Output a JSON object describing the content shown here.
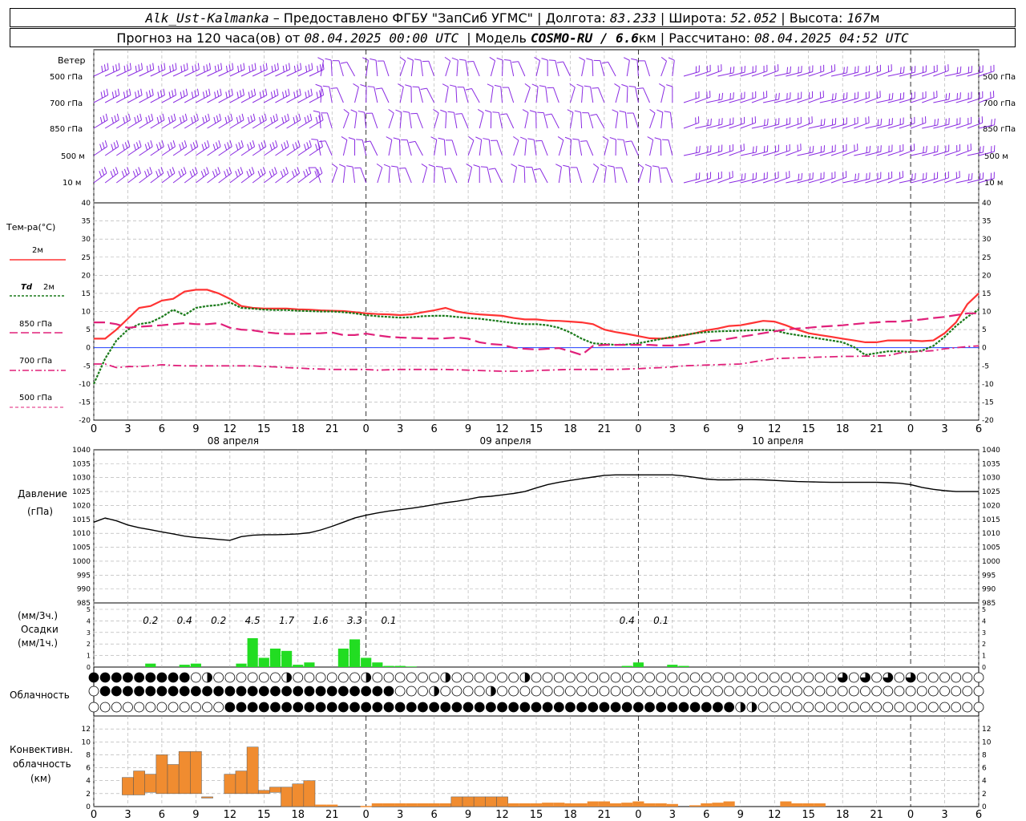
{
  "header": {
    "station": "Alk_Ust-Kalmanka",
    "dash": "–",
    "provider": "Предоставлено ФГБУ \"ЗапСиб УГМС\"",
    "lon_label": "Долгота:",
    "lon": "83.233",
    "lat_label": "Широта:",
    "lat": "52.052",
    "alt_label": "Высота:",
    "alt": "167",
    "alt_unit": "м",
    "forecast_label": "Прогноз на 120 часа(ов) от",
    "forecast_time": "08.04.2025 00:00 UTC",
    "model_label": "Модель",
    "model": "COSMO-RU / 6.6",
    "model_unit": "км",
    "calc_label": "Рассчитано:",
    "calc_time": "08.04.2025 04:52 UTC",
    "sep": "|"
  },
  "labels": {
    "wind": "Ветер",
    "wind_levels": [
      "500 гПа",
      "700 гПа",
      "850 гПа",
      "500 м",
      "10 м"
    ],
    "temp": "Тем-ра(°С)",
    "t2m": "2м",
    "td": "Td",
    "td2": "2м",
    "l850": "850 гПа",
    "l700": "700 гПа",
    "l500": "500 гПа",
    "pressure": "Давление",
    "pressure_unit": "(гПа)",
    "precip_unit3": "(мм/3ч.)",
    "precip": "Осадки",
    "precip_unit1": "(мм/1ч.)",
    "cloud": "Облачность",
    "conv1": "Конвективн.",
    "conv2": "облачность",
    "conv3": "(км)"
  },
  "colors": {
    "t2m": "#ff3333",
    "td": "#1a7a1a",
    "t850": "#e0207a",
    "t700": "#e0207a",
    "t500": "#e0207a",
    "wind": "#8a2be2",
    "precip": "#22dd22",
    "conv": "#f08c30",
    "zero": "#2040ff"
  },
  "chart_data": [
    {
      "type": "line",
      "name": "temperature",
      "x_hours": [
        0,
        1,
        2,
        3,
        4,
        5,
        6,
        7,
        8,
        9,
        10,
        11,
        12,
        13,
        14,
        15,
        16,
        17,
        18,
        19,
        20,
        21,
        22,
        23,
        24,
        25,
        26,
        27,
        28,
        29,
        30,
        31,
        32,
        33,
        34,
        35,
        36,
        37,
        38,
        39,
        40,
        41,
        42,
        43,
        44,
        45,
        46,
        47,
        48,
        49,
        50,
        51,
        52,
        53,
        54,
        55,
        56,
        57,
        58,
        59,
        60,
        61,
        62,
        63,
        64,
        65,
        66,
        67,
        68,
        69,
        70,
        71,
        72,
        73,
        74,
        75,
        76,
        77,
        78
      ],
      "x_tick_labels": [
        "0",
        "3",
        "6",
        "9",
        "12",
        "15",
        "18",
        "21",
        "0",
        "3",
        "6",
        "9",
        "12",
        "15",
        "18",
        "21",
        "0",
        "3",
        "6",
        "9",
        "12",
        "15",
        "18",
        "21",
        "0",
        "3",
        "6"
      ],
      "day_labels": [
        "08 апреля",
        "09 апреля",
        "10 апреля"
      ],
      "ylim": [
        -20,
        40
      ],
      "yticks": [
        40,
        35,
        30,
        25,
        20,
        15,
        10,
        5,
        0,
        -5,
        -10,
        -15,
        -20
      ],
      "series": [
        {
          "name": "2м",
          "values": [
            2.5,
            2.5,
            5,
            8,
            11,
            11.5,
            13,
            13.5,
            15.5,
            16,
            16,
            15,
            13.5,
            11.5,
            11,
            10.8,
            10.8,
            10.8,
            10.6,
            10.5,
            10.3,
            10.2,
            10.1,
            9.8,
            9.5,
            9.3,
            9.2,
            9,
            9.2,
            9.8,
            10.3,
            11,
            10,
            9.5,
            9.2,
            9,
            8.8,
            8.2,
            7.8,
            7.8,
            7.5,
            7.4,
            7.2,
            7,
            6.5,
            5,
            4.3,
            3.8,
            3.2,
            2.6,
            2.5,
            2.8,
            3.4,
            4,
            4.8,
            5.3,
            6,
            6.2,
            6.8,
            7.4,
            7.2,
            6.2,
            5,
            4,
            3.5,
            3,
            2.5,
            2,
            1.5,
            1.5,
            2,
            2,
            2,
            1.8,
            2,
            4,
            7,
            12,
            15
          ]
        },
        {
          "name": "Td 2м",
          "values": [
            -10,
            -3,
            2,
            5,
            6.5,
            7,
            8.5,
            10.5,
            9,
            11,
            11.5,
            11.8,
            12.5,
            11,
            10.8,
            10.5,
            10.4,
            10.4,
            10.2,
            10.1,
            10,
            10,
            9.8,
            9.5,
            9,
            8.7,
            8.5,
            8.3,
            8.4,
            8.7,
            8.8,
            8.8,
            8.5,
            8.2,
            8,
            7.6,
            7.2,
            6.8,
            6.5,
            6.5,
            6.2,
            5.5,
            4.2,
            2.5,
            1.2,
            1,
            0.8,
            0.9,
            1.2,
            1.8,
            2.4,
            3,
            3.5,
            4,
            4.3,
            4.5,
            4.6,
            4.7,
            4.8,
            4.9,
            4.8,
            4,
            3.5,
            3,
            2.5,
            2,
            1.5,
            0.2,
            -2,
            -1.5,
            -1,
            -1,
            -1.2,
            -0.8,
            0.5,
            3,
            6,
            8.5,
            10.5
          ]
        },
        {
          "name": "850 гПа",
          "values": [
            7,
            7,
            6.5,
            5.5,
            5.8,
            6,
            6.2,
            6.5,
            6.8,
            6.5,
            6.5,
            6.8,
            5.5,
            5,
            4.8,
            4.3,
            4,
            3.8,
            3.8,
            3.9,
            4,
            4.2,
            3.5,
            3.5,
            3.9,
            3.4,
            3,
            2.8,
            2.7,
            2.6,
            2.5,
            2.6,
            2.8,
            2.5,
            1.5,
            1,
            0.8,
            0,
            -0.3,
            -0.5,
            -0.3,
            -0.1,
            -1,
            -2,
            0.5,
            0.8,
            0.8,
            0.8,
            0.8,
            0.8,
            0.6,
            0.6,
            0.8,
            1.2,
            1.8,
            2,
            2.5,
            3,
            3.5,
            4,
            4.5,
            5,
            5.3,
            5.5,
            5.8,
            6,
            6.2,
            6.5,
            6.8,
            7,
            7.2,
            7.2,
            7.5,
            7.8,
            8.2,
            8.5,
            9,
            9.5,
            9.5
          ]
        },
        {
          "name": "700 гПа",
          "values": [
            -4.5,
            -4.5,
            -5.5,
            -5.2,
            -5.2,
            -5,
            -4.7,
            -4.9,
            -5,
            -5,
            -5,
            -5,
            -5,
            -5,
            -5,
            -5.2,
            -5.3,
            -5.5,
            -5.6,
            -5.8,
            -5.9,
            -6,
            -6,
            -6,
            -6,
            -6.2,
            -6.1,
            -6,
            -6,
            -6,
            -6,
            -6,
            -6.1,
            -6.2,
            -6.3,
            -6.4,
            -6.5,
            -6.5,
            -6.5,
            -6.3,
            -6.2,
            -6.1,
            -6,
            -6,
            -6,
            -6,
            -6,
            -5.9,
            -5.8,
            -5.6,
            -5.5,
            -5.3,
            -5,
            -4.9,
            -4.8,
            -4.7,
            -4.6,
            -4.5,
            -4,
            -3.5,
            -3,
            -2.9,
            -2.8,
            -2.7,
            -2.6,
            -2.5,
            -2.4,
            -2.4,
            -2.3,
            -2.3,
            -2.2,
            -1.5,
            -1.2,
            -1,
            -0.8,
            -0.3,
            0,
            0.3,
            0.5
          ]
        }
      ],
      "zero_line": 0
    },
    {
      "type": "line",
      "name": "pressure",
      "ylim": [
        985,
        1040
      ],
      "yticks": [
        1040,
        1035,
        1030,
        1025,
        1020,
        1015,
        1010,
        1005,
        1000,
        995,
        990,
        985
      ],
      "values": [
        1014,
        1015.5,
        1014.5,
        1013,
        1012,
        1011.3,
        1010.5,
        1009.8,
        1009,
        1008.5,
        1008.2,
        1007.8,
        1007.5,
        1008.8,
        1009.3,
        1009.5,
        1009.5,
        1009.6,
        1009.8,
        1010.2,
        1011.2,
        1012.5,
        1014,
        1015.5,
        1016.5,
        1017.3,
        1018,
        1018.5,
        1019,
        1019.6,
        1020.3,
        1021,
        1021.5,
        1022.2,
        1023,
        1023.3,
        1023.8,
        1024.3,
        1025,
        1026.3,
        1027.5,
        1028.3,
        1029,
        1029.6,
        1030.2,
        1030.8,
        1031,
        1031,
        1031,
        1031,
        1031,
        1031,
        1030.6,
        1030.1,
        1029.5,
        1029.2,
        1029.2,
        1029.3,
        1029.3,
        1029.2,
        1029,
        1028.8,
        1028.6,
        1028.5,
        1028.4,
        1028.3,
        1028.3,
        1028.3,
        1028.3,
        1028.3,
        1028.2,
        1028,
        1027.5,
        1026.5,
        1025.8,
        1025.3,
        1025,
        1025,
        1025
      ]
    },
    {
      "type": "bar",
      "name": "precipitation",
      "ylim": [
        0,
        5
      ],
      "yticks": [
        5,
        4,
        3,
        2,
        1,
        0
      ],
      "mm_per_hour": [
        0,
        0,
        0,
        0,
        0,
        0.3,
        0,
        0,
        0.2,
        0.3,
        0,
        0,
        0,
        0.3,
        2.5,
        0.8,
        1.6,
        1.4,
        0.2,
        0.4,
        0,
        0,
        1.6,
        2.4,
        0.8,
        0.4,
        0.1,
        0.1,
        0.05,
        0,
        0,
        0,
        0,
        0,
        0,
        0,
        0,
        0,
        0,
        0,
        0,
        0,
        0,
        0,
        0,
        0,
        0,
        0.1,
        0.4,
        0,
        0,
        0.2,
        0.1,
        0,
        0,
        0,
        0,
        0,
        0,
        0,
        0,
        0,
        0,
        0,
        0,
        0,
        0,
        0,
        0,
        0,
        0,
        0,
        0,
        0,
        0,
        0,
        0,
        0
      ],
      "mm_per_3h_labels": [
        "0.2",
        "0.4",
        "0.2",
        "4.5",
        "1.7",
        "1.6",
        "3.3",
        "0.1",
        "0.4",
        "0.1"
      ]
    },
    {
      "type": "bar",
      "name": "convective_cloud",
      "ylim": [
        0,
        14
      ],
      "yticks": [
        12,
        10,
        8,
        6,
        4,
        2,
        0
      ],
      "tops": [
        0,
        0,
        0,
        4.5,
        5.5,
        5,
        8,
        6.5,
        8.5,
        8.5,
        1.5,
        0,
        5,
        5.5,
        9.2,
        2.5,
        3,
        3,
        3.5,
        4,
        0.3,
        0.3,
        0,
        0,
        0.1,
        0.5,
        0.5,
        0.5,
        0.5,
        0.5,
        0.5,
        0.5,
        1.5,
        1.5,
        1.5,
        1.5,
        1.5,
        0.5,
        0.5,
        0.5,
        0.6,
        0.6,
        0.5,
        0.5,
        0.8,
        0.8,
        0.5,
        0.6,
        0.8,
        0.5,
        0.5,
        0.4,
        0,
        0.2,
        0.5,
        0.6,
        0.8,
        0,
        0,
        0,
        0,
        0.8,
        0.5,
        0.5,
        0.5,
        0,
        0,
        0,
        0,
        0,
        0,
        0,
        0,
        0,
        0,
        0,
        0,
        0,
        0
      ],
      "bases": [
        0,
        0,
        0,
        1.8,
        1.8,
        2.2,
        2,
        2,
        2,
        2,
        1.5,
        0,
        2,
        2,
        2,
        2,
        2.2,
        0,
        0,
        0,
        0,
        0,
        0,
        0,
        0,
        0,
        0,
        0,
        0,
        0,
        0,
        0,
        0,
        0,
        0,
        0,
        0,
        0,
        0,
        0,
        0,
        0,
        0,
        0,
        0,
        0,
        0,
        0,
        0,
        0,
        0,
        0,
        0,
        0,
        0,
        0,
        0,
        0,
        0,
        0,
        0,
        0,
        0,
        0,
        0,
        0,
        0,
        0,
        0,
        0,
        0,
        0,
        0,
        0,
        0,
        0,
        0,
        0,
        0
      ]
    }
  ]
}
